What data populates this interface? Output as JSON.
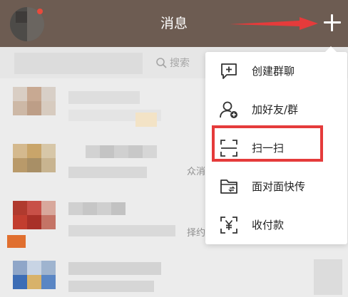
{
  "header": {
    "title": "消息",
    "add_label": "+"
  },
  "search": {
    "placeholder": "搜索"
  },
  "list": {
    "snippet_1": "众消",
    "snippet_2": "择约"
  },
  "menu": {
    "items": [
      {
        "label": "创建群聊",
        "icon": "chat-add-icon"
      },
      {
        "label": "加好友/群",
        "icon": "add-friend-icon"
      },
      {
        "label": "扫一扫",
        "icon": "scan-icon"
      },
      {
        "label": "面对面快传",
        "icon": "folder-transfer-icon"
      },
      {
        "label": "收付款",
        "icon": "yuan-payment-icon"
      }
    ]
  },
  "colors": {
    "header_bg": "#6d5c52",
    "highlight_red": "#e53b3b",
    "arrow_red": "#e53b3b"
  }
}
